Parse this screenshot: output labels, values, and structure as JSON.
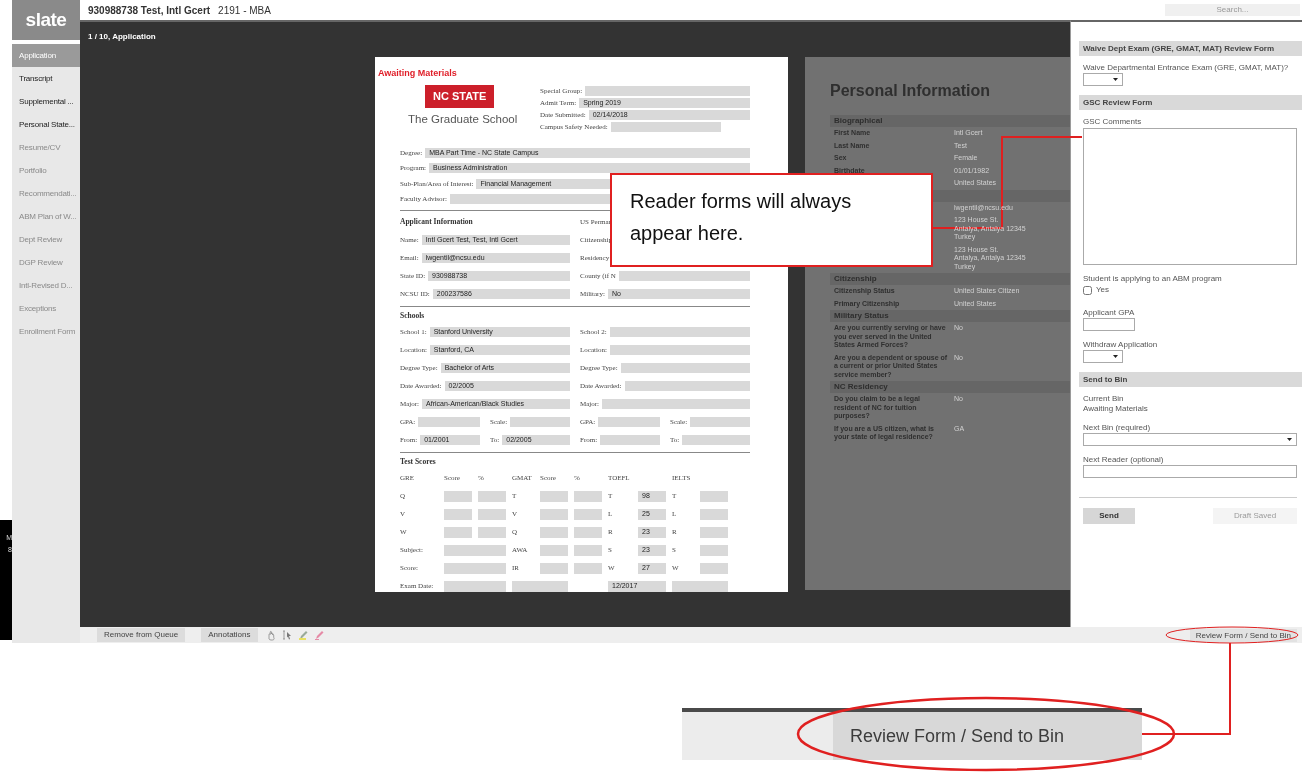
{
  "header": {
    "title": "930988738 Test, Intl Gcert",
    "subtitle": "2191 - MBA",
    "search": {
      "placeholder": "Search..."
    }
  },
  "logo": "slate",
  "sidebar": {
    "items": [
      {
        "label": "Application",
        "selected": true,
        "disabled": false
      },
      {
        "label": "Transcript",
        "selected": false,
        "disabled": false
      },
      {
        "label": "Supplemental ...",
        "selected": false,
        "disabled": false
      },
      {
        "label": "Personal State...",
        "selected": false,
        "disabled": false
      },
      {
        "label": "Resume/CV",
        "selected": false,
        "disabled": true
      },
      {
        "label": "Portfolio",
        "selected": false,
        "disabled": true
      },
      {
        "label": "Recommendati...",
        "selected": false,
        "disabled": true
      },
      {
        "label": "ABM Plan of W...",
        "selected": false,
        "disabled": true
      },
      {
        "label": "Dept Review",
        "selected": false,
        "disabled": true
      },
      {
        "label": "DGP Review",
        "selected": false,
        "disabled": true
      },
      {
        "label": "Intl-Revised D...",
        "selected": false,
        "disabled": true
      },
      {
        "label": "Exceptions",
        "selected": false,
        "disabled": true
      },
      {
        "label": "Enrollment Form",
        "selected": false,
        "disabled": true
      }
    ]
  },
  "edge_strip": [
    "M",
    "8"
  ],
  "viewer": {
    "position": "1 / 10, Application",
    "document": {
      "status": "Awaiting Materials",
      "logo": "NC STATE",
      "school": "The Graduate School",
      "header_fields": [
        {
          "label": "Special Group:"
        },
        {
          "label": "Admit Term:",
          "value": "Spring 2019"
        },
        {
          "label": "Date Submitted:",
          "value": "02/14/2018"
        },
        {
          "label": "Campus Safety Needed:"
        }
      ],
      "rows": [
        {
          "kind": "fields",
          "fields": [
            {
              "kind": "field",
              "label": "Degree:",
              "value": "MBA Part Time - NC State Campus"
            }
          ]
        },
        {
          "kind": "fields",
          "fields": [
            {
              "kind": "field",
              "label": "Program:",
              "value": "Business Administration"
            }
          ]
        },
        {
          "kind": "fields",
          "fields": [
            {
              "kind": "field",
              "label": "Sub-Plan/Area of Interest:",
              "value": "Financial Management"
            }
          ]
        },
        {
          "kind": "fields",
          "fields": [
            {
              "kind": "field",
              "label": "Faculty Advisor:"
            }
          ]
        },
        {
          "kind": "rule"
        },
        {
          "kind": "fields",
          "fields": [
            {
              "kind": "heading",
              "label": "Applicant Information"
            },
            {
              "kind": "label",
              "label": "US Perman"
            }
          ]
        },
        {
          "kind": "fields",
          "fields": [
            {
              "kind": "field",
              "label": "Name:",
              "value": "Intl Gcert Test, Test, Intl Gcert"
            },
            {
              "kind": "label",
              "label": "Citizenship"
            }
          ]
        },
        {
          "kind": "fields",
          "fields": [
            {
              "kind": "field",
              "label": "Email:",
              "value": "lwgentil@ncsu.edu"
            },
            {
              "kind": "label",
              "label": "Residency"
            }
          ]
        },
        {
          "kind": "fields",
          "fields": [
            {
              "kind": "field",
              "label": "State ID:",
              "value": "930988738"
            },
            {
              "kind": "field",
              "label": "County (if N"
            }
          ]
        },
        {
          "kind": "fields",
          "fields": [
            {
              "kind": "field",
              "label": "NCSU ID:",
              "value": "200237586"
            },
            {
              "kind": "field",
              "label": "Military:",
              "value": "No"
            }
          ]
        },
        {
          "kind": "rule"
        },
        {
          "kind": "heading",
          "label": "Schools"
        },
        {
          "kind": "fields",
          "fields": [
            {
              "kind": "field",
              "label": "School 1:",
              "value": "Stanford University"
            },
            {
              "kind": "field",
              "label": "School 2:"
            }
          ]
        },
        {
          "kind": "fields",
          "fields": [
            {
              "kind": "field",
              "label": "Location:",
              "value": "Stanford, CA"
            },
            {
              "kind": "field",
              "label": "Location:"
            }
          ]
        },
        {
          "kind": "fields",
          "fields": [
            {
              "kind": "field",
              "label": "Degree Type:",
              "value": "Bachelor of Arts"
            },
            {
              "kind": "field",
              "label": "Degree Type:"
            }
          ]
        },
        {
          "kind": "fields",
          "fields": [
            {
              "kind": "field",
              "label": "Date Awarded:",
              "value": "02/2005"
            },
            {
              "kind": "field",
              "label": "Date Awarded:"
            }
          ]
        },
        {
          "kind": "fields",
          "fields": [
            {
              "kind": "field",
              "label": "Major:",
              "value": "African-American/Black Studies"
            },
            {
              "kind": "field",
              "label": "Major:"
            }
          ]
        },
        {
          "kind": "fields",
          "fields": [
            {
              "kind": "field",
              "label": "GPA:"
            },
            {
              "kind": "field",
              "label": "Scale:"
            },
            {
              "kind": "field",
              "label": "GPA:"
            },
            {
              "kind": "field",
              "label": "Scale:"
            }
          ]
        },
        {
          "kind": "fields",
          "fields": [
            {
              "kind": "field",
              "label": "From:",
              "value": "01/2001"
            },
            {
              "kind": "field",
              "label": "To:",
              "value": "02/2005"
            },
            {
              "kind": "field",
              "label": "From:"
            },
            {
              "kind": "field",
              "label": "To:"
            }
          ]
        },
        {
          "kind": "rule"
        },
        {
          "kind": "heading",
          "label": "Test Scores"
        }
      ],
      "test_scores": [
        [
          {
            "kind": "label",
            "text": "GRE"
          },
          {
            "kind": "label",
            "text": "Score"
          },
          {
            "kind": "label",
            "text": "%"
          },
          {
            "kind": "label",
            "text": "GMAT"
          },
          {
            "kind": "label",
            "text": "Score"
          },
          {
            "kind": "label",
            "text": "%"
          },
          {
            "kind": "label",
            "text": "TOEFL"
          },
          {
            "kind": "gap"
          },
          {
            "kind": "label",
            "text": "IELTS"
          },
          {
            "kind": "gap"
          }
        ],
        [
          {
            "kind": "label",
            "text": "Q"
          },
          {
            "kind": "box"
          },
          {
            "kind": "box"
          },
          {
            "kind": "label",
            "text": "T"
          },
          {
            "kind": "box"
          },
          {
            "kind": "box"
          },
          {
            "kind": "label",
            "text": "T"
          },
          {
            "kind": "box",
            "value": "98"
          },
          {
            "kind": "label",
            "text": "T"
          },
          {
            "kind": "box"
          }
        ],
        [
          {
            "kind": "label",
            "text": "V"
          },
          {
            "kind": "box"
          },
          {
            "kind": "box"
          },
          {
            "kind": "label",
            "text": "V"
          },
          {
            "kind": "box"
          },
          {
            "kind": "box"
          },
          {
            "kind": "label",
            "text": "L"
          },
          {
            "kind": "box",
            "value": "25"
          },
          {
            "kind": "label",
            "text": "L"
          },
          {
            "kind": "box"
          }
        ],
        [
          {
            "kind": "label",
            "text": "W"
          },
          {
            "kind": "box"
          },
          {
            "kind": "box"
          },
          {
            "kind": "label",
            "text": "Q"
          },
          {
            "kind": "box"
          },
          {
            "kind": "box"
          },
          {
            "kind": "label",
            "text": "R"
          },
          {
            "kind": "box",
            "value": "23"
          },
          {
            "kind": "label",
            "text": "R"
          },
          {
            "kind": "box"
          }
        ],
        [
          {
            "kind": "label",
            "text": "Subject:"
          },
          {
            "kind": "wide"
          },
          {
            "kind": "label",
            "text": "AWA"
          },
          {
            "kind": "box"
          },
          {
            "kind": "box"
          },
          {
            "kind": "label",
            "text": "S"
          },
          {
            "kind": "box",
            "value": "23"
          },
          {
            "kind": "label",
            "text": "S"
          },
          {
            "kind": "box"
          }
        ],
        [
          {
            "kind": "label",
            "text": "Score:"
          },
          {
            "kind": "wide"
          },
          {
            "kind": "label",
            "text": "IR"
          },
          {
            "kind": "box"
          },
          {
            "kind": "box"
          },
          {
            "kind": "label",
            "text": "W"
          },
          {
            "kind": "box",
            "value": "27"
          },
          {
            "kind": "label",
            "text": "W"
          },
          {
            "kind": "box"
          }
        ],
        [
          {
            "kind": "label",
            "text": "Exam Date:"
          },
          {
            "kind": "wide"
          },
          {
            "kind": "wide"
          },
          {
            "kind": "gap"
          },
          {
            "kind": "wide",
            "value": "12/2017"
          },
          {
            "kind": "wide"
          }
        ]
      ]
    },
    "personal_info": {
      "title": "Personal Information",
      "sections": [
        {
          "title": "Biographical",
          "rows": [
            {
              "label": "First Name",
              "value": "Intl Gcert"
            },
            {
              "label": "Last Name",
              "value": "Test"
            },
            {
              "label": "Sex",
              "value": "Female"
            },
            {
              "label": "Birthdate",
              "value": "01/01/1982"
            },
            {
              "value": "United States"
            }
          ]
        },
        {
          "rows": [
            {
              "value": "lwgentil@ncsu.edu"
            },
            {
              "value": "123 House St.\nAntalya, Antalya 12345\nTurkey"
            },
            {
              "value": "123 House St.\nAntalya, Antalya 12345\nTurkey"
            }
          ]
        },
        {
          "title": "Citizenship",
          "rows": [
            {
              "label": "Citizenship Status",
              "value": "United States Citizen"
            },
            {
              "label": "Primary Citizenship",
              "value": "United States"
            }
          ]
        },
        {
          "title": "Military Status",
          "rows": [
            {
              "label": "Are you currently serving or have you ever served in the United States Armed Forces?",
              "value": "No"
            },
            {
              "label": "Are you a dependent or spouse of a current or prior United States service member?",
              "value": "No"
            }
          ]
        },
        {
          "title": "NC Residency",
          "rows": [
            {
              "label": "Do you claim to be a legal resident of NC for tuition purposes?",
              "value": "No"
            },
            {
              "label": "If you are a US citizen, what is your state of legal residence?",
              "value": "GA"
            }
          ]
        }
      ]
    }
  },
  "review_panel": {
    "sections": [
      {
        "title": "Waive Dept Exam (GRE, GMAT, MAT) Review Form",
        "items": [
          {
            "kind": "select",
            "label": "Waive Departmental Entrance Exam (GRE, GMAT, MAT)?"
          }
        ]
      },
      {
        "title": "GSC Review Form",
        "items": [
          {
            "kind": "textarea",
            "label": "GSC Comments"
          },
          {
            "kind": "checkbox",
            "label": "Student is applying to an ABM program",
            "option": "Yes",
            "checked": false
          },
          {
            "kind": "text",
            "label": "Applicant GPA"
          },
          {
            "kind": "select",
            "label": "Withdraw Application"
          }
        ]
      },
      {
        "title": "Send to Bin",
        "items": [
          {
            "kind": "info",
            "label": "Current Bin",
            "value": "Awaiting Materials"
          },
          {
            "kind": "wide-select",
            "label": "Next Bin (required)"
          },
          {
            "kind": "wide-text",
            "label": "Next Reader (optional)"
          }
        ]
      }
    ],
    "send": "Send",
    "draft": {
      "label": "Draft Saved",
      "disabled": true
    }
  },
  "bottom_bar": {
    "buttons": [
      "Remove from Queue",
      "Annotations"
    ],
    "tools": [
      {
        "kind": "hand"
      },
      {
        "kind": "select"
      },
      {
        "kind": "highlight"
      },
      {
        "kind": "pen"
      }
    ],
    "review_button": "Review Form / Send to Bin"
  },
  "callouts": [
    {
      "kind": "note",
      "text": "Reader forms will always appear here."
    },
    {
      "kind": "zoom",
      "label": "Review Form / Send to Bin"
    }
  ]
}
